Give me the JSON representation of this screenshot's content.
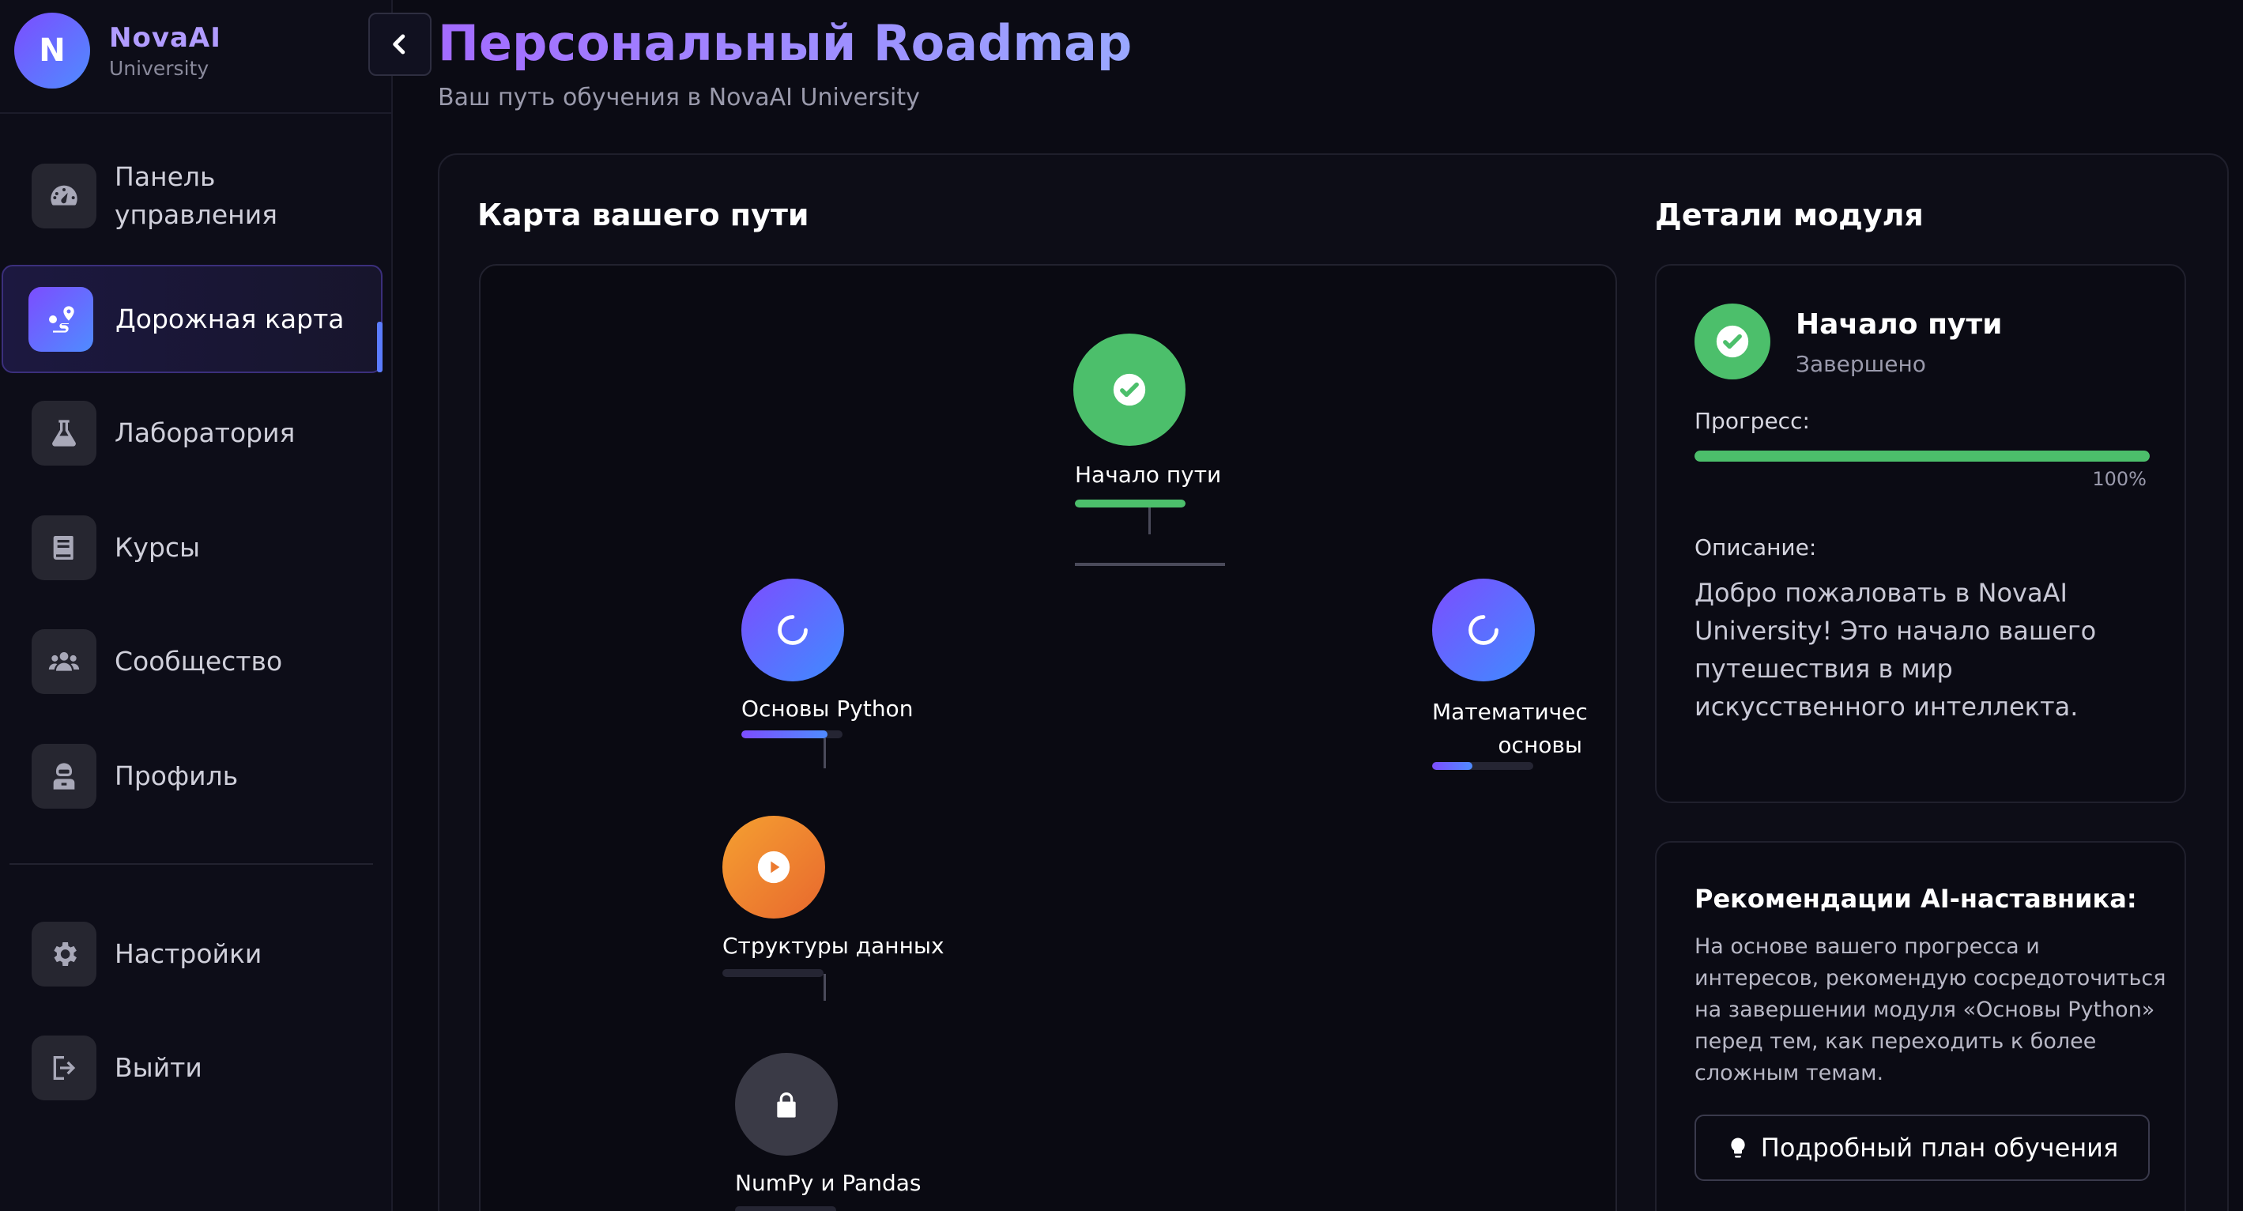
{
  "brand": {
    "initial": "N",
    "name": "NovaAI",
    "sub": "University"
  },
  "sidebar": {
    "items": [
      {
        "label": "Панель\nуправления",
        "icon": "gauge-icon"
      },
      {
        "label": "Дорожная карта",
        "icon": "route-icon",
        "active": true
      },
      {
        "label": "Лаборатория",
        "icon": "flask-icon"
      },
      {
        "label": "Курсы",
        "icon": "book-icon"
      },
      {
        "label": "Сообщество",
        "icon": "users-icon"
      },
      {
        "label": "Профиль",
        "icon": "astronaut-icon"
      }
    ],
    "bottom_items": [
      {
        "label": "Настройки",
        "icon": "gear-icon"
      },
      {
        "label": "Выйти",
        "icon": "logout-icon"
      }
    ]
  },
  "header": {
    "title": "Персональный Roadmap",
    "subtitle": "Ваш путь обучения в NovaAI University"
  },
  "map": {
    "title": "Карта вашего пути",
    "nodes": [
      {
        "label": "Начало пути",
        "status": "completed",
        "progress": 100,
        "icon": "check-icon"
      },
      {
        "label": "Основы Python",
        "status": "in-progress",
        "progress": 85,
        "icon": "spinner-icon"
      },
      {
        "label": "Математичес\nосновы",
        "status": "in-progress",
        "progress": 40,
        "icon": "spinner-icon"
      },
      {
        "label": "Структуры данных",
        "status": "available",
        "progress": 0,
        "icon": "play-icon"
      },
      {
        "label": "NumPy и Pandas",
        "status": "locked",
        "progress": 0,
        "icon": "lock-icon"
      }
    ]
  },
  "details": {
    "title": "Детали модуля",
    "module_name": "Начало пути",
    "module_status": "Завершено",
    "progress_label": "Прогресс:",
    "progress_value": 100,
    "progress_text": "100%",
    "description_label": "Описание:",
    "description": "Добро пожаловать в NovaAI University! Это начало вашего путешествия в мир искусственного интеллекта."
  },
  "recommendations": {
    "title": "Рекомендации AI-наставника:",
    "text": "На основе вашего прогресса и интересов, рекомендую сосредоточиться на завершении модуля «Основы Python» перед тем, как переходить к более сложным темам.",
    "button_label": "Подробный план обучения"
  },
  "colors": {
    "accent": "#7c4dff",
    "accent2": "#4f8cff",
    "success": "#4cbf6b",
    "orange": "#f08a2e",
    "locked": "#3a3a46",
    "background": "#0b0b14"
  }
}
